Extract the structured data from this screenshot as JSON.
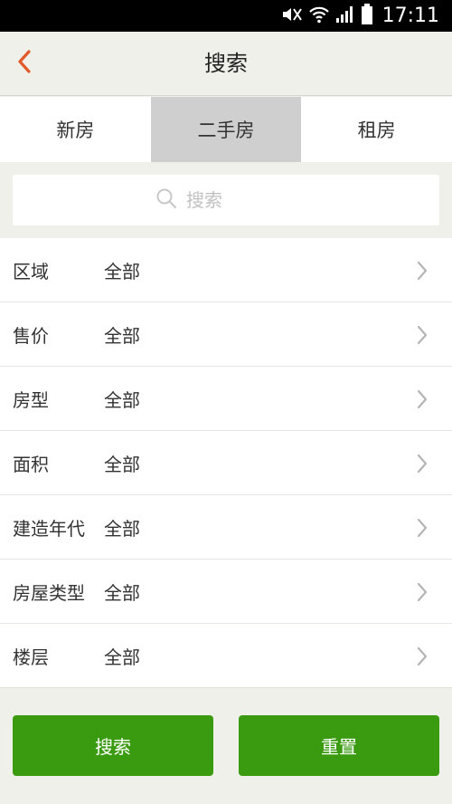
{
  "status_bar": {
    "time": "17:11"
  },
  "header": {
    "title": "搜索"
  },
  "tabs": [
    {
      "label": "新房",
      "active": false
    },
    {
      "label": "二手房",
      "active": true
    },
    {
      "label": "租房",
      "active": false
    }
  ],
  "search": {
    "placeholder": "搜索",
    "value": ""
  },
  "filters": [
    {
      "label": "区域",
      "value": "全部"
    },
    {
      "label": "售价",
      "value": "全部"
    },
    {
      "label": "房型",
      "value": "全部"
    },
    {
      "label": "面积",
      "value": "全部"
    },
    {
      "label": "建造年代",
      "value": "全部"
    },
    {
      "label": "房屋类型",
      "value": "全部"
    },
    {
      "label": "楼层",
      "value": "全部"
    }
  ],
  "buttons": {
    "search_label": "搜索",
    "reset_label": "重置"
  },
  "colors": {
    "accent_green": "#3a9b10",
    "back_arrow": "#e2592a",
    "tab_active_bg": "#cfcfcf"
  }
}
